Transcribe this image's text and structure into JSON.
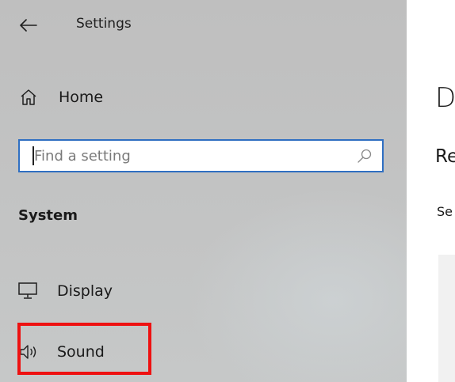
{
  "window": {
    "title": "Settings"
  },
  "sidebar": {
    "home_label": "Home",
    "search": {
      "placeholder": "Find a setting",
      "value": ""
    },
    "section_header": "System",
    "items": [
      {
        "label": "Display",
        "icon": "monitor-icon"
      },
      {
        "label": "Sound",
        "icon": "speaker-icon",
        "highlighted": true
      }
    ]
  },
  "main": {
    "title_fragment": "D",
    "subtitle_fragment": "Re",
    "text_fragment": "Se"
  },
  "colors": {
    "sidebar_bg": "#c0c1c1",
    "search_border": "#2f6fc2",
    "highlight_border": "#ee1111"
  }
}
